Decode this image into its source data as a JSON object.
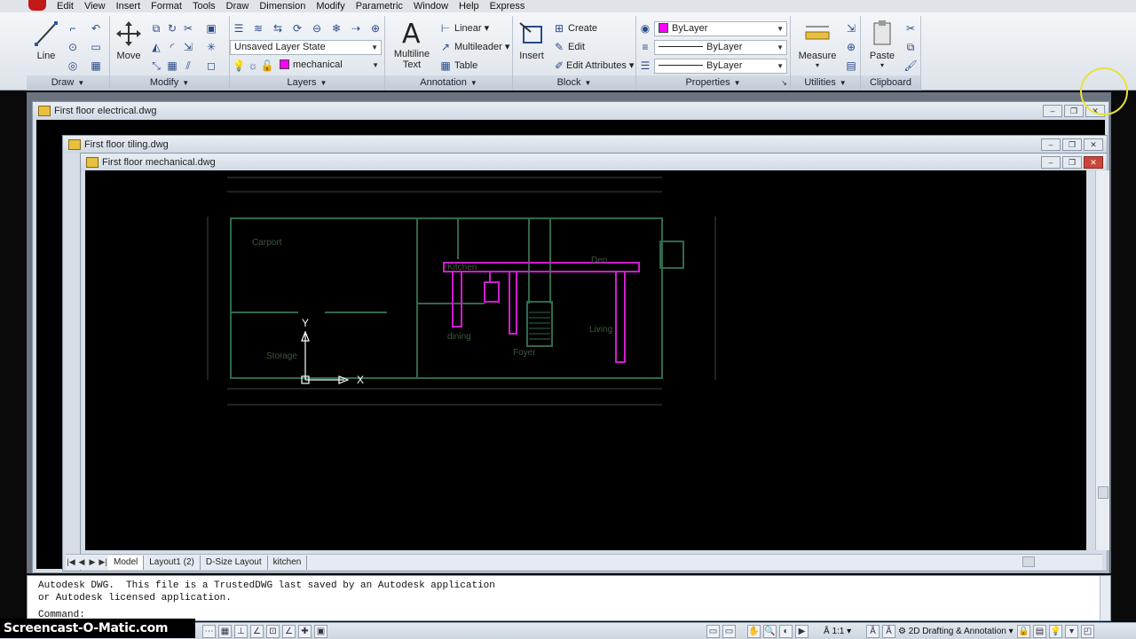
{
  "menubar": {
    "items": [
      "Edit",
      "View",
      "Insert",
      "Format",
      "Tools",
      "Draw",
      "Dimension",
      "Modify",
      "Parametric",
      "Window",
      "Help",
      "Express"
    ]
  },
  "ribbon": {
    "draw": {
      "title": "Draw",
      "line_label": "Line"
    },
    "modify": {
      "title": "Modify",
      "move_label": "Move"
    },
    "layers": {
      "title": "Layers",
      "layer_state": "Unsaved Layer State",
      "current_layer": "mechanical"
    },
    "annotation": {
      "title": "Annotation",
      "mtext_label_1": "Multiline",
      "mtext_label_2": "Text",
      "linear": "Linear",
      "multileader": "Multileader",
      "table": "Table"
    },
    "block": {
      "title": "Block",
      "insert": "Insert",
      "create": "Create",
      "edit": "Edit",
      "edit_attributes": "Edit Attributes"
    },
    "properties": {
      "title": "Properties",
      "color": "ByLayer",
      "linetype": "ByLayer",
      "lineweight": "ByLayer"
    },
    "utilities": {
      "title": "Utilities",
      "measure": "Measure"
    },
    "clipboard": {
      "title": "Clipboard",
      "paste": "Paste"
    }
  },
  "documents": [
    {
      "title": "First floor electrical.dwg"
    },
    {
      "title": "First floor tiling.dwg"
    },
    {
      "title": "First floor mechanical.dwg"
    }
  ],
  "drawing": {
    "rooms": [
      "Carport",
      "Storage",
      "dining",
      "Foyer",
      "Living",
      "Kitchen",
      "Den"
    ],
    "ucs_x": "X",
    "ucs_y": "Y"
  },
  "layout_tabs": [
    "Model",
    "Layout1 (2)",
    "D-Size Layout",
    "kitchen"
  ],
  "command_line": {
    "history_1": "Autodesk DWG.  This file is a TrustedDWG last saved by an Autodesk application",
    "history_2": "or Autodesk licensed application.",
    "prompt": "Command:"
  },
  "statusbar": {
    "scale": "1:1",
    "workspace": "2D Drafting & Annotation"
  },
  "watermark": "Screencast-O-Matic.com",
  "colors": {
    "layer_mechanical": "#ff00ff",
    "canvas_bg": "#000000",
    "wall_lines": "#2f6f4f"
  }
}
